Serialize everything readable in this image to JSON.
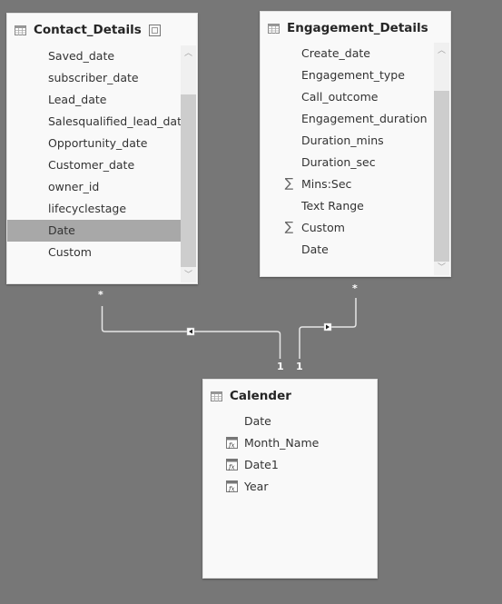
{
  "tables": {
    "contact_details": {
      "title": "Contact_Details",
      "icon": "table-icon",
      "has_expand_button": true,
      "fields": [
        {
          "name": "Saved_date",
          "icon": null
        },
        {
          "name": "subscriber_date",
          "icon": null
        },
        {
          "name": "Lead_date",
          "icon": null
        },
        {
          "name": "Salesqualified_lead_date",
          "icon": null
        },
        {
          "name": "Opportunity_date",
          "icon": null
        },
        {
          "name": "Customer_date",
          "icon": null
        },
        {
          "name": "owner_id",
          "icon": null
        },
        {
          "name": "lifecyclestage",
          "icon": null
        },
        {
          "name": "Date",
          "icon": null,
          "selected": true
        },
        {
          "name": "Custom",
          "icon": null
        }
      ]
    },
    "engagement_details": {
      "title": "Engagement_Details",
      "icon": "table-icon",
      "fields": [
        {
          "name": "Create_date",
          "icon": null
        },
        {
          "name": "Engagement_type",
          "icon": null
        },
        {
          "name": "Call_outcome",
          "icon": null
        },
        {
          "name": "Engagement_duration",
          "icon": null
        },
        {
          "name": "Duration_mins",
          "icon": null
        },
        {
          "name": "Duration_sec",
          "icon": null
        },
        {
          "name": "Mins:Sec",
          "icon": "sigma"
        },
        {
          "name": "Text Range",
          "icon": null
        },
        {
          "name": "Custom",
          "icon": "sigma"
        },
        {
          "name": "Date",
          "icon": null
        }
      ]
    },
    "calender": {
      "title": "Calender",
      "icon": "table-icon",
      "fields": [
        {
          "name": "Date",
          "icon": null
        },
        {
          "name": "Month_Name",
          "icon": "calculated-column"
        },
        {
          "name": "Date1",
          "icon": "calculated-column"
        },
        {
          "name": "Year",
          "icon": "calculated-column"
        }
      ]
    }
  },
  "relationships": [
    {
      "from": "Contact_Details",
      "to": "Calender",
      "from_cardinality": "*",
      "to_cardinality": "1",
      "direction": "single"
    },
    {
      "from": "Engagement_Details",
      "to": "Calender",
      "from_cardinality": "*",
      "to_cardinality": "1",
      "direction": "single"
    }
  ],
  "icons": {
    "sigma": "∑",
    "scroll_up": "︿",
    "scroll_down": "﹀"
  }
}
